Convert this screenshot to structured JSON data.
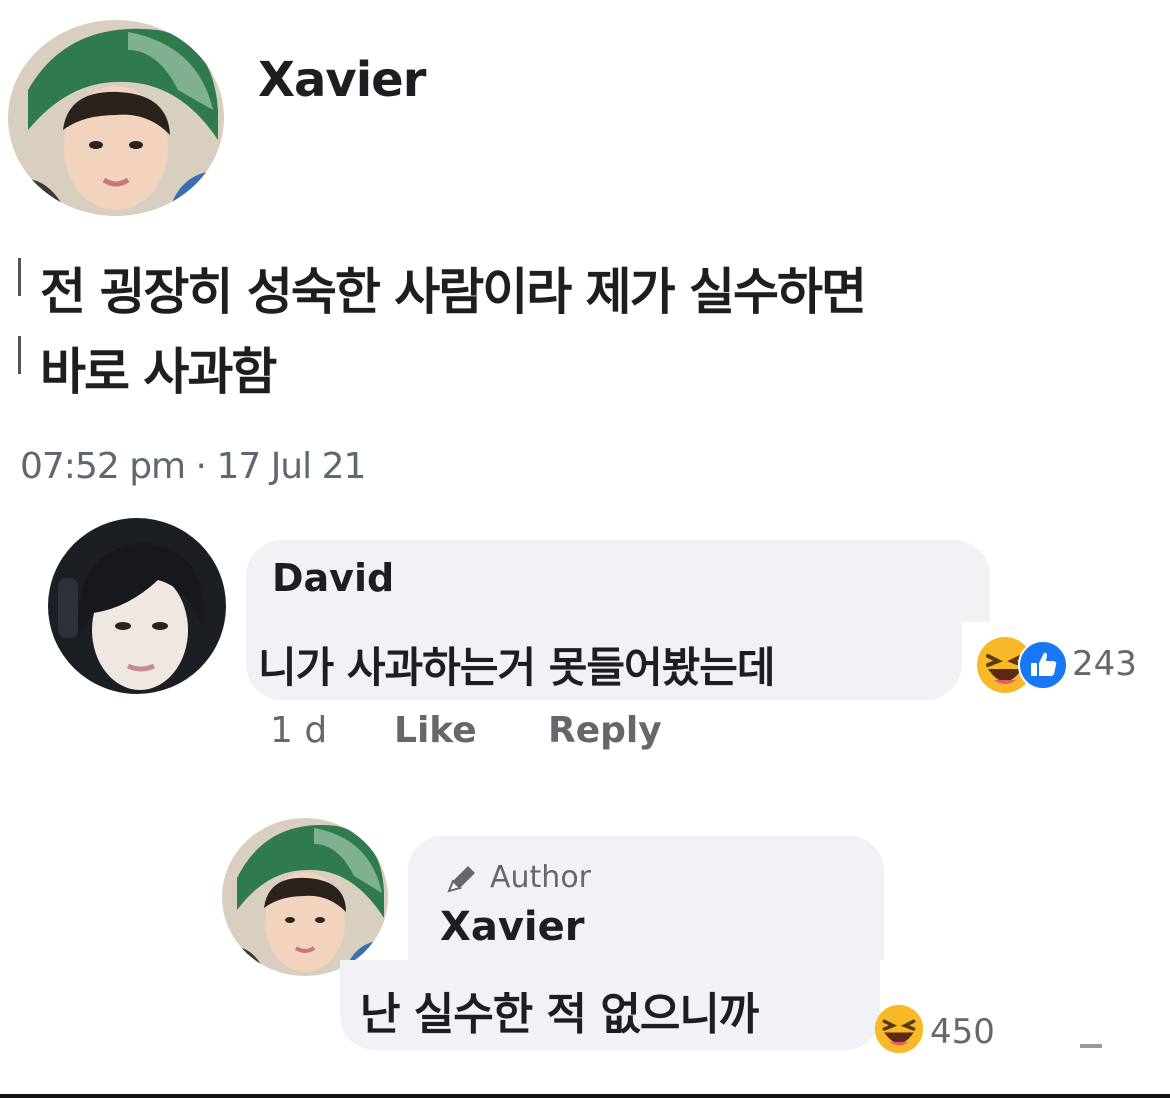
{
  "post": {
    "author": "Xavier",
    "text_line1": "전 굉장히 성숙한 사람이라 제가 실수하면",
    "text_line2": "바로 사과함",
    "timestamp": "07:52 pm · 17 Jul 21"
  },
  "comments": [
    {
      "author": "David",
      "text": "니가 사과하는거 못들어봤는데",
      "time": "1 d",
      "like_label": "Like",
      "reply_label": "Reply",
      "reaction_count": "243",
      "reactions": [
        "haha-icon",
        "like-icon"
      ]
    },
    {
      "badge": "Author",
      "author": "Xavier",
      "text": "난 실수한 적 없으니까",
      "reaction_count": "450",
      "reactions": [
        "haha-icon"
      ]
    }
  ],
  "colors": {
    "bubble": "#f0f2f5",
    "like_blue": "#1877f2",
    "haha_yellow": "#f7b928",
    "muted_text": "#65676b"
  }
}
